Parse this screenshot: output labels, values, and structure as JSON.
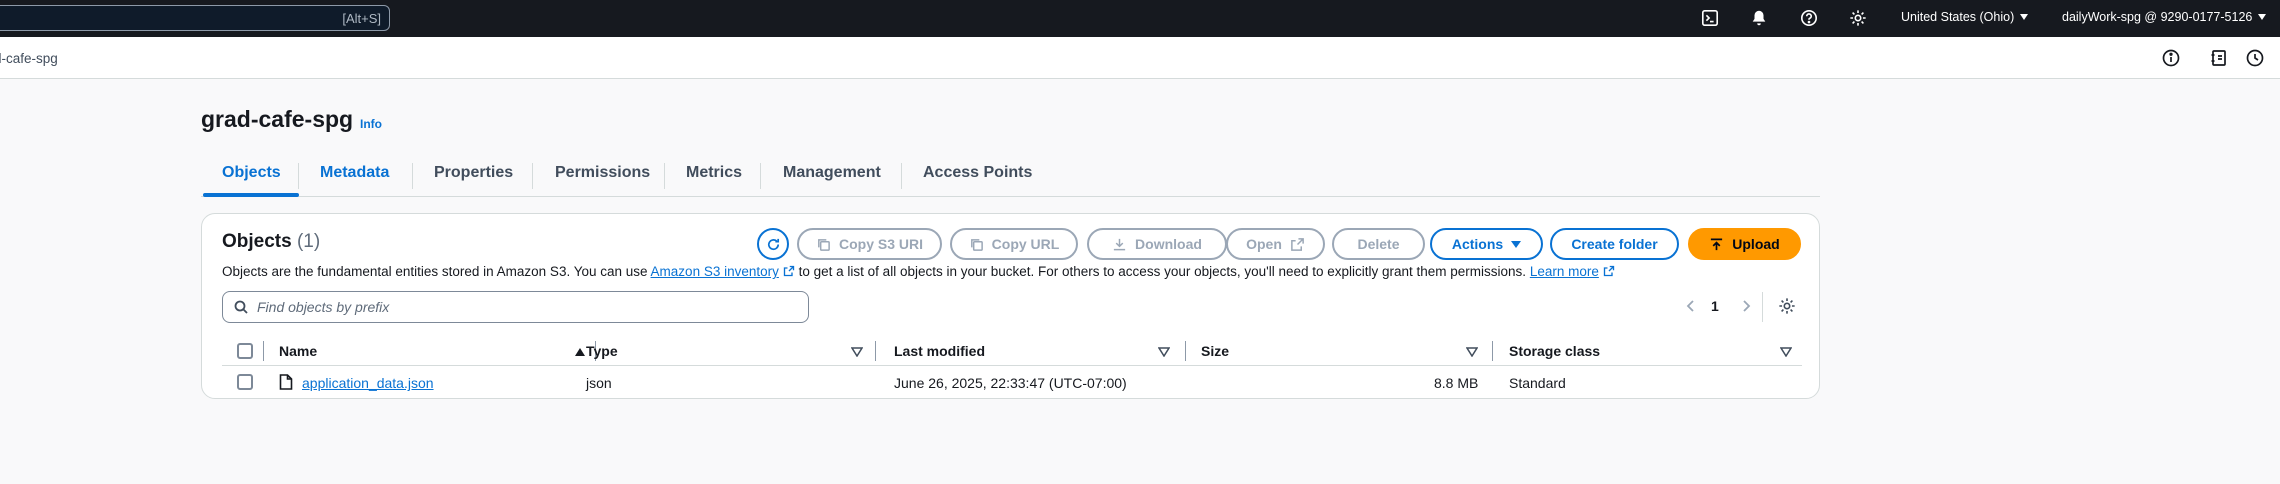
{
  "topbar": {
    "search_shortcut": "[Alt+S]",
    "region": "United States (Ohio)",
    "account": "dailyWork-spg @ 9290-0177-5126",
    "icons": [
      "cloudshell-icon",
      "bell-icon",
      "help-icon",
      "settings-icon"
    ]
  },
  "breadcrumb": {
    "current": "d-cafe-spg",
    "icons": [
      "info-circle-icon",
      "notebook-icon",
      "clock-icon"
    ]
  },
  "page": {
    "title": "grad-cafe-spg",
    "info_link": "Info"
  },
  "tabs": [
    {
      "label": "Objects",
      "active": true
    },
    {
      "label": "Metadata",
      "active": false
    },
    {
      "label": "Properties",
      "active": false
    },
    {
      "label": "Permissions",
      "active": false
    },
    {
      "label": "Metrics",
      "active": false
    },
    {
      "label": "Management",
      "active": false
    },
    {
      "label": "Access Points",
      "active": false
    }
  ],
  "objects_panel": {
    "heading": "Objects",
    "count": "(1)",
    "buttons": {
      "copy_s3_uri": "Copy S3 URI",
      "copy_url": "Copy URL",
      "download": "Download",
      "open": "Open",
      "delete": "Delete",
      "actions": "Actions",
      "create_folder": "Create folder",
      "upload": "Upload"
    },
    "description": {
      "part1": "Objects are the fundamental entities stored in Amazon S3. You can use",
      "inventory_link": "Amazon S3 inventory",
      "part2": "to get a list of all objects in your bucket. For others to access your objects, you'll need to explicitly grant them permissions.",
      "learn_more": "Learn more"
    },
    "filter_placeholder": "Find objects by prefix",
    "pagination": {
      "current_page": "1"
    }
  },
  "table": {
    "columns": [
      "Name",
      "Type",
      "Last modified",
      "Size",
      "Storage class"
    ],
    "rows": [
      {
        "name": "application_data.json",
        "type": "json",
        "last_modified": "June 26, 2025, 22:33:47 (UTC-07:00)",
        "size": "8.8 MB",
        "storage_class": "Standard"
      }
    ]
  },
  "colors": {
    "accent": "#0972d3",
    "upload": "#ff9900",
    "topbar": "#16191f"
  }
}
